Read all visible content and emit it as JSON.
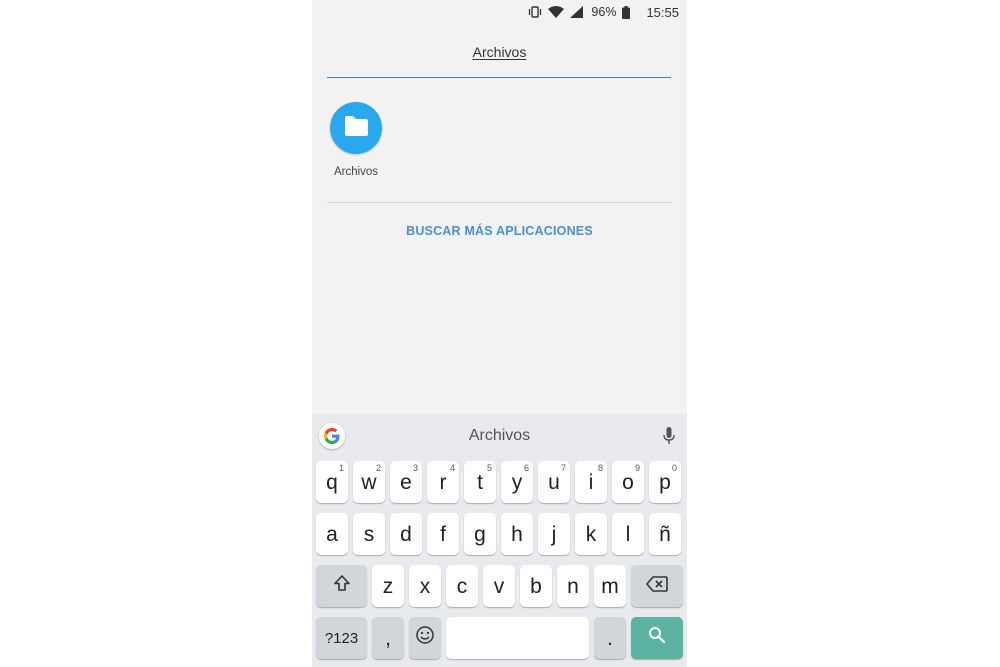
{
  "status_bar": {
    "icons": [
      "vibrate-icon",
      "wifi-icon",
      "signal-icon"
    ],
    "battery": "96%",
    "battery_icon": "battery-icon",
    "time": "15:55"
  },
  "search": {
    "query": "Archivos"
  },
  "results": {
    "apps": [
      {
        "label": "Archivos",
        "icon": "folder-icon",
        "color": "#29a8ee"
      }
    ],
    "more_apps_label": "BUSCAR MÁS APLICACIONES"
  },
  "keyboard": {
    "suggestion": "Archivos",
    "row1": [
      {
        "char": "q",
        "num": "1"
      },
      {
        "char": "w",
        "num": "2"
      },
      {
        "char": "e",
        "num": "3"
      },
      {
        "char": "r",
        "num": "4"
      },
      {
        "char": "t",
        "num": "5"
      },
      {
        "char": "y",
        "num": "6"
      },
      {
        "char": "u",
        "num": "7"
      },
      {
        "char": "i",
        "num": "8"
      },
      {
        "char": "o",
        "num": "9"
      },
      {
        "char": "p",
        "num": "0"
      }
    ],
    "row2": [
      "a",
      "s",
      "d",
      "f",
      "g",
      "h",
      "j",
      "k",
      "l",
      "ñ"
    ],
    "row3": [
      "z",
      "x",
      "c",
      "v",
      "b",
      "n",
      "m"
    ],
    "symbols_label": "?123",
    "comma": ",",
    "period": ".",
    "enter_color": "#5db3a2"
  }
}
